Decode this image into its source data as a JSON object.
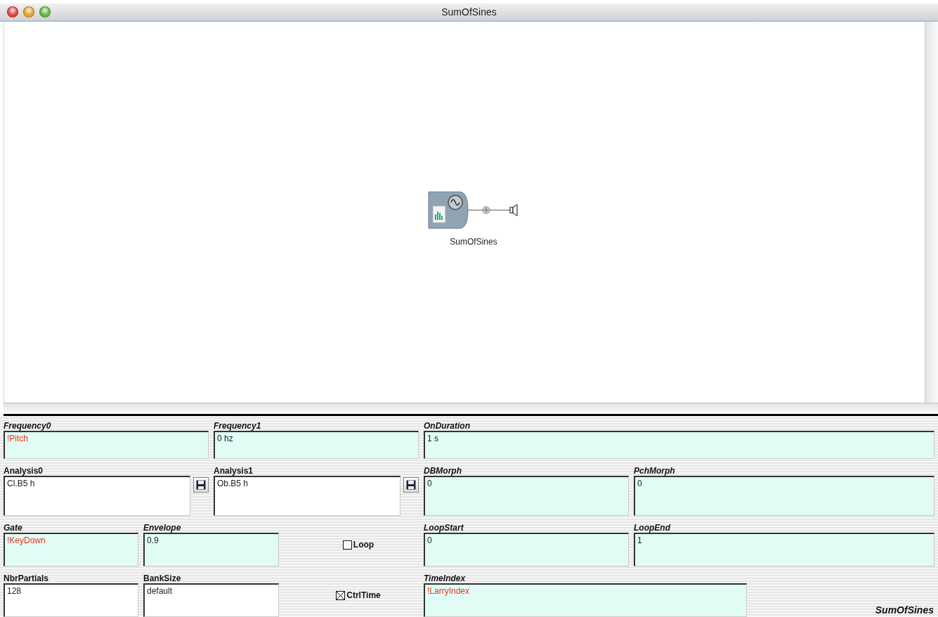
{
  "window": {
    "title": "SumOfSines"
  },
  "canvas": {
    "node": {
      "label": "SumOfSines"
    }
  },
  "parameter_rows": [
    [
      {
        "kind": "field",
        "label": "Frequency0",
        "value": "!Pitch",
        "hot": true,
        "variable": true
      },
      {
        "kind": "field",
        "label": "Frequency1",
        "value": "0 hz",
        "hot": true,
        "variable": false
      },
      {
        "kind": "field",
        "label": "OnDuration",
        "value": "1 s",
        "hot": true,
        "variable": false
      }
    ],
    [
      {
        "kind": "file",
        "label": "Analysis0",
        "value": "Cl.B5 h",
        "hot": false,
        "variable": false
      },
      {
        "kind": "file",
        "label": "Analysis1",
        "value": "Ob.B5 h",
        "hot": false,
        "variable": false
      },
      {
        "kind": "field",
        "label": "DBMorph",
        "value": "0",
        "hot": true,
        "variable": false
      },
      {
        "kind": "field",
        "label": "PchMorph",
        "value": "0",
        "hot": true,
        "variable": false
      }
    ],
    [
      {
        "kind": "field",
        "label": "Gate",
        "value": "!KeyDown",
        "hot": true,
        "variable": true
      },
      {
        "kind": "field",
        "label": "Envelope",
        "value": "0.9",
        "hot": true,
        "variable": false
      },
      {
        "kind": "checkbox",
        "label": "Loop",
        "checked": false
      },
      {
        "kind": "field",
        "label": "LoopStart",
        "value": "0",
        "hot": true,
        "variable": false
      },
      {
        "kind": "field",
        "label": "LoopEnd",
        "value": "1",
        "hot": true,
        "variable": false
      }
    ],
    [
      {
        "kind": "field",
        "label": "NbrPartials",
        "value": "128",
        "hot": false,
        "variable": false
      },
      {
        "kind": "field",
        "label": "BankSize",
        "value": "default",
        "hot": false,
        "variable": false
      },
      {
        "kind": "checkbox",
        "label": "CtrlTime",
        "checked": true
      },
      {
        "kind": "field",
        "label": "TimeIndex",
        "value": "!LarryIndex",
        "hot": true,
        "variable": true
      }
    ]
  ],
  "footer_label": "SumOfSines"
}
